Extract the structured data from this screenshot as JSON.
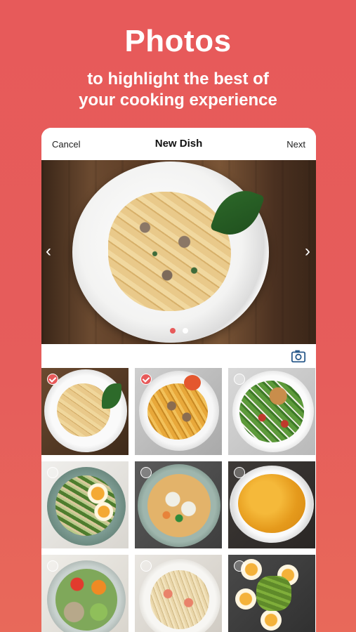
{
  "hero": {
    "title": "Photos",
    "subtitle_line1": "to highlight the best of",
    "subtitle_line2": "your cooking experience"
  },
  "nav": {
    "cancel": "Cancel",
    "title": "New Dish",
    "next": "Next"
  },
  "carousel": {
    "pages": 2,
    "active_page": 1
  },
  "colors": {
    "brand": "#e75a5a",
    "accent_blue": "#2b5b8c"
  },
  "gallery": {
    "items": [
      {
        "dish": "creamy mushroom penne",
        "selected": true
      },
      {
        "dish": "mushroom tagliatelle",
        "selected": true
      },
      {
        "dish": "chicken caesar salad",
        "selected": false
      },
      {
        "dish": "egg and vegetable bowl",
        "selected": false
      },
      {
        "dish": "dumpling soup",
        "selected": false
      },
      {
        "dish": "pumpkin soup",
        "selected": false
      },
      {
        "dish": "vegetable quinoa bowl",
        "selected": false
      },
      {
        "dish": "shrimp spaghetti",
        "selected": false
      },
      {
        "dish": "egg and avocado salad",
        "selected": false
      }
    ]
  },
  "icons": {
    "camera": "camera-icon",
    "prev": "chevron-left-icon",
    "next": "chevron-right-icon",
    "check": "checkmark-icon"
  }
}
